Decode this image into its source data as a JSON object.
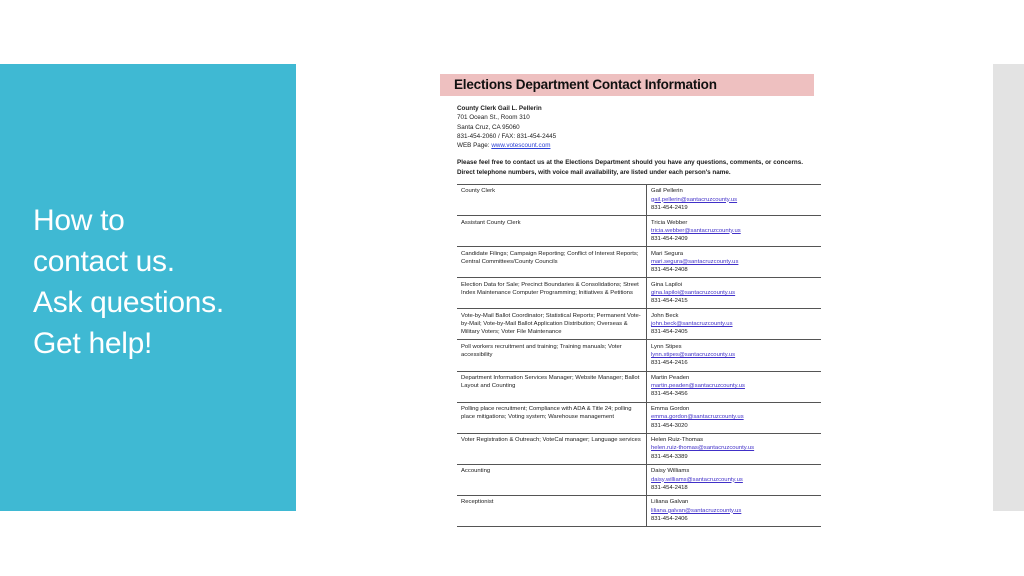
{
  "slide": {
    "title_text": "How to\ncontact us.\nAsk questions.\nGet help!",
    "accent_color": "#3fb9d3",
    "header_band_color": "#eec0c0",
    "side_strip_color": "#e3e3e3"
  },
  "document": {
    "header_title": "Elections Department Contact Information",
    "address": {
      "clerk_line": "County Clerk Gail L. Pellerin",
      "street": "701 Ocean St., Room 310",
      "city_state_zip": "Santa Cruz, CA  95060",
      "phone_fax": "831-454-2060 / FAX: 831-454-2445",
      "web_label": "WEB Page: ",
      "web_url": "www.votescount.com"
    },
    "intro": "Please feel free to contact us at the Elections Department should you have any questions, comments, or concerns.  Direct telephone numbers, with voice mail availability, are listed under each person's name.",
    "rows": [
      {
        "role": "County Clerk",
        "name": "Gail Pellerin",
        "email": "gail.pellerin@santacruzcounty.us",
        "phone": "831-454-2419"
      },
      {
        "role": "Assistant County Clerk",
        "name": "Tricia Webber",
        "email": "tricia.webber@santacruzcounty.us",
        "phone": "831-454-2409"
      },
      {
        "role": "Candidate Filings; Campaign Reporting; Conflict of Interest Reports; Central Committees/County Councils",
        "name": "Mari Segura",
        "email": "mari.segura@santacruzcounty.us",
        "phone": "831-454-2408"
      },
      {
        "role": "Election Data for Sale; Precinct Boundaries & Consolidations; Street Index Maintenance Computer Programming; Initiatives & Petitions",
        "name": "Gina Lapiloi",
        "email": "gina.lapiloi@santacruzcounty.us",
        "phone": "831-454-2415"
      },
      {
        "role": "Vote-by-Mail Ballot Coordinator; Statistical Reports; Permanent Vote-by-Mail; Vote-by-Mail Ballot Application Distribution; Overseas & Military Voters; Voter File Maintenance",
        "name": "John Beck",
        "email": "john.beck@santacruzcounty.us",
        "phone": "831-454-2405"
      },
      {
        "role": "Poll workers recruitment and training; Training manuals; Voter accessibility",
        "name": "Lynn Stipes",
        "email": "lynn.stipes@santacruzcounty.us",
        "phone": "831-454-2416"
      },
      {
        "role": "Department Information Services Manager; Website Manager; Ballot Layout and Counting",
        "name": "Martin Peaden",
        "email": "martin.peaden@santacruzcounty.us",
        "phone": "831-454-3456"
      },
      {
        "role": "Polling place recruitment; Compliance with ADA & Title 24; polling place mitigations; Voting system; Warehouse management",
        "name": "Emma Gordon",
        "email": "emma.gordon@santacruzcounty.us",
        "phone": "831-454-3020"
      },
      {
        "role": "Voter Registration & Outreach; VoteCal manager; Language services",
        "name": "Helen Ruiz-Thomas",
        "email": "helen.ruiz-thomas@santacruzcounty.us",
        "phone": "831-454-3389"
      },
      {
        "role": "Accounting",
        "name": "Daisy Williams",
        "email": "daisy.williams@santacruzcounty.us",
        "phone": "831-454-2418"
      },
      {
        "role": "Receptionist",
        "name": "Liliana Galvan",
        "email": "liliana.galvan@santacruzcounty.us",
        "phone": "831-454-2406"
      }
    ]
  }
}
